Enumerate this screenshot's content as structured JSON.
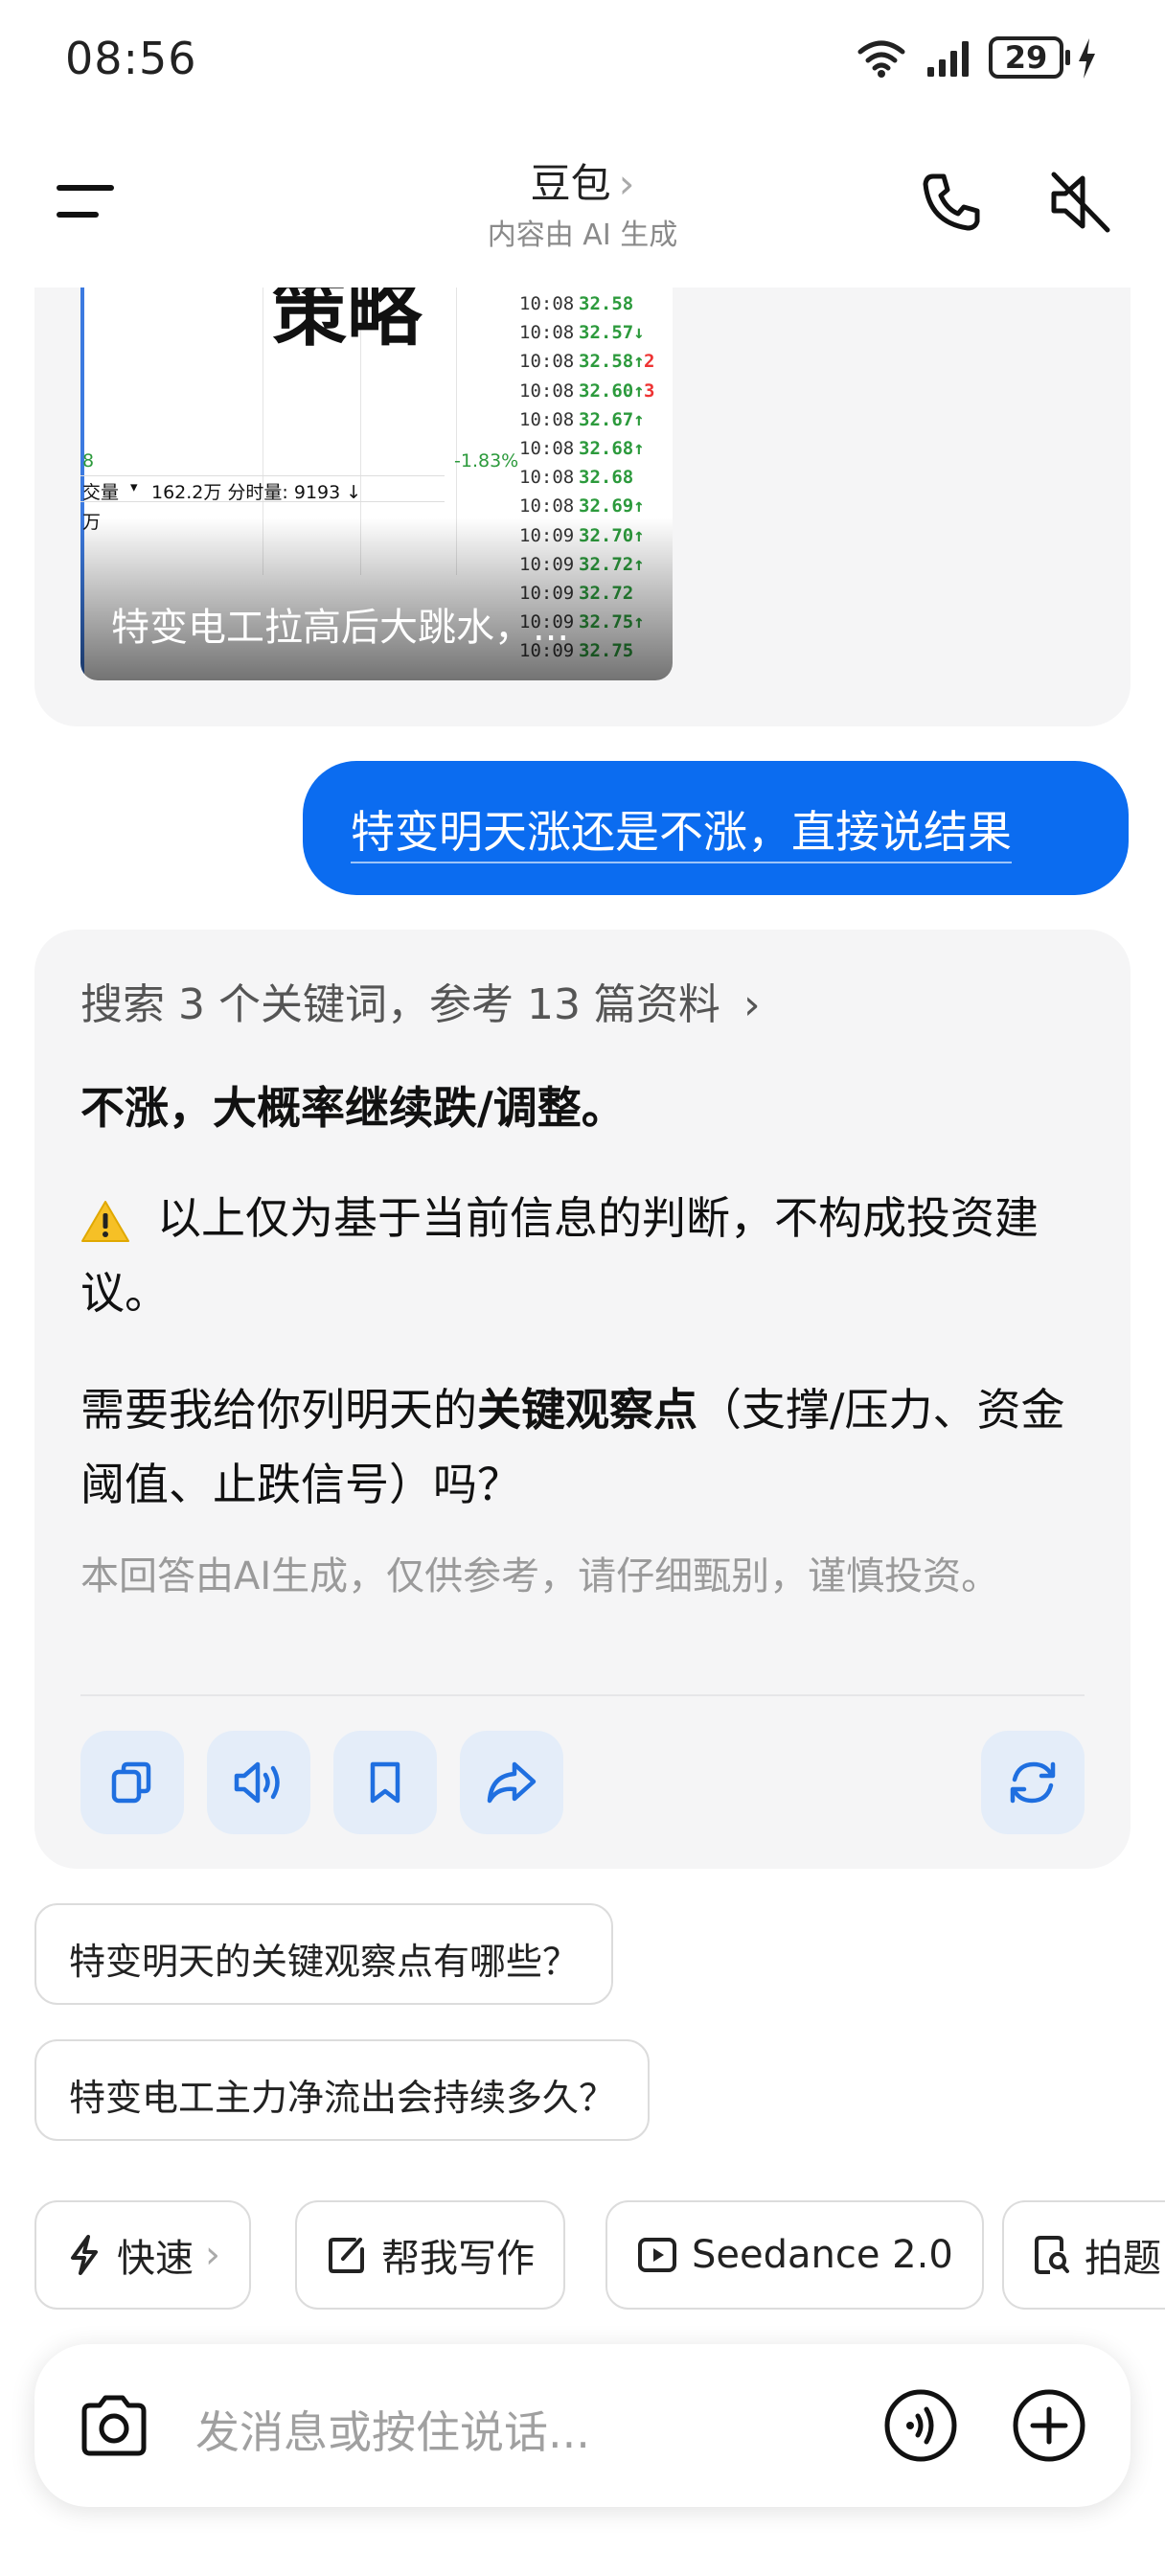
{
  "status_bar": {
    "time": "08:56",
    "battery": "29"
  },
  "header": {
    "title": "豆包",
    "title_chevron": "›",
    "subtitle": "内容由 AI 生成"
  },
  "preview": {
    "headline_fragment": "策略",
    "pct_change": "-1.83%",
    "volume_label": "交量",
    "volume_text": "162.2万 分时量: 9193 ↓",
    "unit_fragment": "万",
    "left_fragment": "8",
    "ticks": [
      {
        "t": "10:08",
        "p": "32.58",
        "a": ""
      },
      {
        "t": "10:08",
        "p": "32.57↓",
        "a": ""
      },
      {
        "t": "10:08",
        "p": "32.58↑",
        "a": "2"
      },
      {
        "t": "10:08",
        "p": "32.60↑",
        "a": "3"
      },
      {
        "t": "10:08",
        "p": "32.67↑",
        "a": ""
      },
      {
        "t": "10:08",
        "p": "32.68↑",
        "a": ""
      },
      {
        "t": "10:08",
        "p": "32.68",
        "a": ""
      },
      {
        "t": "10:08",
        "p": "32.69↑",
        "a": ""
      },
      {
        "t": "10:09",
        "p": "32.70↑",
        "a": ""
      },
      {
        "t": "10:09",
        "p": "32.72↑",
        "a": ""
      },
      {
        "t": "10:09",
        "p": "32.72",
        "a": ""
      },
      {
        "t": "10:09",
        "p": "32.75↑",
        "a": ""
      },
      {
        "t": "10:09",
        "p": "32.75",
        "a": ""
      }
    ],
    "caption": "特变电工拉高后大跳水，..."
  },
  "user_message": "特变明天涨还是不涨，直接说结果",
  "ai_answer": {
    "search_summary": "搜索 3 个关键词，参考 13 篇资料",
    "search_chevron": "›",
    "main_answer": "不涨，大概率继续跌/调整。",
    "warning": "以上仅为基于当前信息的判断，不构成投资建议。",
    "ask_prefix": "需要我给你列明天的",
    "ask_bold": "关键观察点",
    "ask_suffix": "（支撑/压力、资金阈值、止跌信号）吗？",
    "disclaimer": "本回答由AI生成，仅供参考，请仔细甄别，谨慎投资。",
    "actions": [
      "copy-icon",
      "speaker-icon",
      "bookmark-icon",
      "share-icon",
      "regenerate-icon"
    ]
  },
  "suggestions": [
    "特变明天的关键观察点有哪些？",
    "特变电工主力净流出会持续多久？"
  ],
  "shortcuts": [
    {
      "label": "快速",
      "chevron": "›",
      "icon": "lightning-icon"
    },
    {
      "label": "帮我写作",
      "icon": "edit-icon"
    },
    {
      "label": "Seedance 2.0",
      "icon": "play-icon"
    },
    {
      "label": "拍题",
      "icon": "photo-search-icon"
    }
  ],
  "input": {
    "placeholder": "发消息或按住说话..."
  },
  "colors": {
    "accent": "#0b6cf0",
    "card_bg": "#f5f5f6",
    "action_bg": "#e4edf9",
    "action_icon": "#1f6fe0"
  }
}
